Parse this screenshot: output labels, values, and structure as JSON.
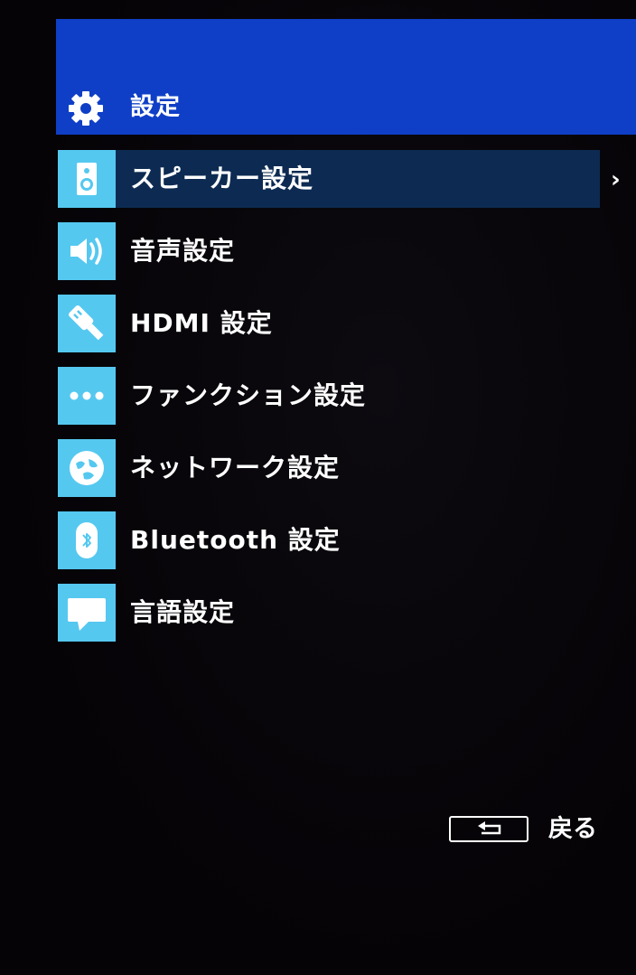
{
  "header": {
    "title": "設定",
    "icon": "gear-icon"
  },
  "menu": {
    "items": [
      {
        "label": "スピーカー設定",
        "icon": "speaker-icon",
        "selected": true
      },
      {
        "label": "音声設定",
        "icon": "volume-icon",
        "selected": false
      },
      {
        "label": "HDMI 設定",
        "icon": "hdmi-plug-icon",
        "selected": false
      },
      {
        "label": "ファンクション設定",
        "icon": "more-dots-icon",
        "selected": false
      },
      {
        "label": "ネットワーク設定",
        "icon": "network-globe-icon",
        "selected": false
      },
      {
        "label": "Bluetooth 設定",
        "icon": "bluetooth-icon",
        "selected": false
      },
      {
        "label": "言語設定",
        "icon": "speech-bubble-icon",
        "selected": false
      }
    ]
  },
  "footer": {
    "back_label": "戻る",
    "back_key_icon": "return-arrow-icon"
  },
  "colors": {
    "header_bg": "#0f3fc6",
    "tile_bg": "#55c8f0",
    "selected_bg": "#0d2b52",
    "screen_bg": "#050306"
  }
}
